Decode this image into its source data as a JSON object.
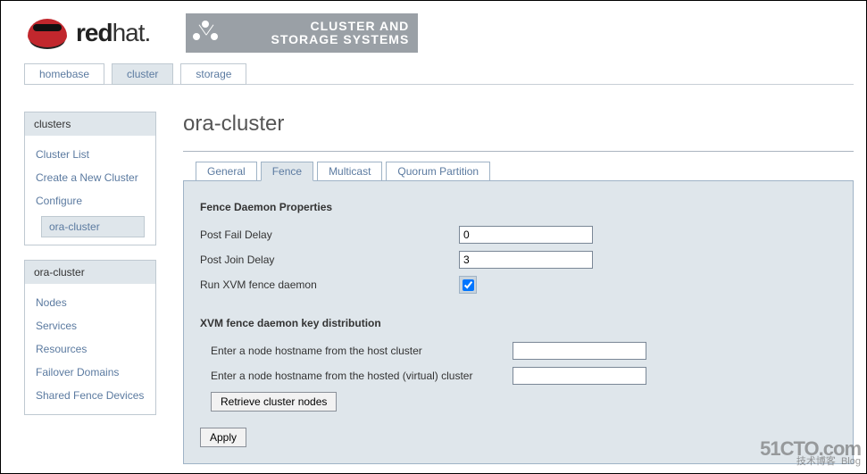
{
  "brand": {
    "name_prefix": "red",
    "name_suffix": "hat",
    "dot": "."
  },
  "banner": {
    "line1": "CLUSTER AND",
    "line2": "STORAGE SYSTEMS"
  },
  "topnav": [
    {
      "label": "homebase",
      "active": false
    },
    {
      "label": "cluster",
      "active": true
    },
    {
      "label": "storage",
      "active": false
    }
  ],
  "sidebar": {
    "clusters": {
      "title": "clusters",
      "items": [
        {
          "label": "Cluster List"
        },
        {
          "label": "Create a New Cluster"
        },
        {
          "label": "Configure"
        },
        {
          "label": "ora-cluster",
          "selected": true
        }
      ]
    },
    "context": {
      "title": "ora-cluster",
      "items": [
        {
          "label": "Nodes"
        },
        {
          "label": "Services"
        },
        {
          "label": "Resources"
        },
        {
          "label": "Failover Domains"
        },
        {
          "label": "Shared Fence Devices"
        }
      ]
    }
  },
  "main": {
    "title": "ora-cluster",
    "tabs": [
      {
        "label": "General"
      },
      {
        "label": "Fence",
        "active": true
      },
      {
        "label": "Multicast"
      },
      {
        "label": "Quorum Partition"
      }
    ],
    "fence": {
      "section1_title": "Fence Daemon Properties",
      "post_fail_label": "Post Fail Delay",
      "post_fail_value": "0",
      "post_join_label": "Post Join Delay",
      "post_join_value": "3",
      "run_xvm_label": "Run XVM fence daemon",
      "run_xvm_checked": true,
      "section2_title": "XVM fence daemon key distribution",
      "host_label": "Enter a node hostname from the host cluster",
      "host_value": "",
      "virt_label": "Enter a node hostname from the hosted (virtual) cluster",
      "virt_value": "",
      "retrieve_btn": "Retrieve cluster nodes",
      "apply_btn": "Apply"
    }
  },
  "watermark": {
    "big": "51CTO.com",
    "line2": "技术博客",
    "tag": "Blog"
  }
}
